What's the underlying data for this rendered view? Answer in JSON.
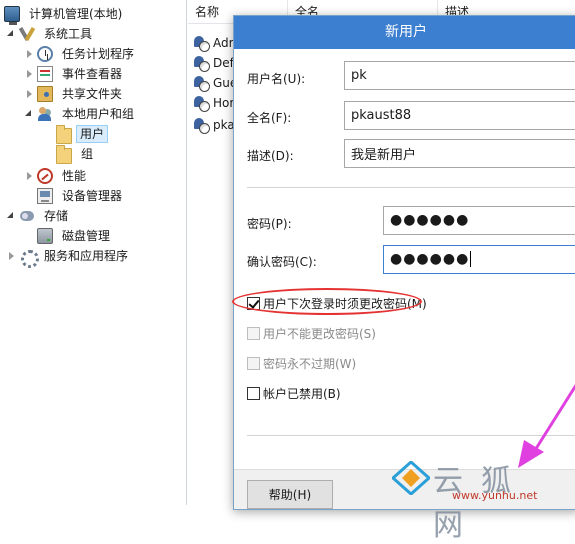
{
  "tree": {
    "items": [
      {
        "label": "计算机管理(本地)",
        "icon": "computer-management-icon"
      },
      {
        "label": "系统工具",
        "icon": "system-tools-icon"
      },
      {
        "label": "任务计划程序",
        "icon": "task-scheduler-icon"
      },
      {
        "label": "事件查看器",
        "icon": "event-viewer-icon"
      },
      {
        "label": "共享文件夹",
        "icon": "shared-folders-icon"
      },
      {
        "label": "本地用户和组",
        "icon": "local-users-groups-icon"
      },
      {
        "label": "用户",
        "icon": "folder-icon"
      },
      {
        "label": "组",
        "icon": "folder-icon"
      },
      {
        "label": "性能",
        "icon": "performance-icon"
      },
      {
        "label": "设备管理器",
        "icon": "device-manager-icon"
      },
      {
        "label": "存储",
        "icon": "storage-icon"
      },
      {
        "label": "磁盘管理",
        "icon": "disk-management-icon"
      },
      {
        "label": "服务和应用程序",
        "icon": "services-applications-icon"
      }
    ]
  },
  "list": {
    "columns": [
      "名称",
      "全名",
      "描述"
    ],
    "rows": [
      "Adr",
      "Def",
      "Gue",
      "Hor",
      "pka"
    ]
  },
  "dialog": {
    "title": "新用户",
    "username_label": "用户名(U):",
    "username_value": "pk",
    "fullname_label": "全名(F):",
    "fullname_value": "pkaust88",
    "description_label": "描述(D):",
    "description_value": "我是新用户",
    "password_label": "密码(P):",
    "password_value": "●●●●●●",
    "confirm_label": "确认密码(C):",
    "confirm_value": "●●●●●●",
    "checkboxes": [
      {
        "label": "用户下次登录时须更改密码(M)",
        "checked": true,
        "enabled": true
      },
      {
        "label": "用户不能更改密码(S)",
        "checked": false,
        "enabled": false
      },
      {
        "label": "密码永不过期(W)",
        "checked": false,
        "enabled": false
      },
      {
        "label": "帐户已禁用(B)",
        "checked": false,
        "enabled": true
      }
    ],
    "help_button": "帮助(H)"
  },
  "watermark": {
    "text": "云狐网",
    "url": "www.yunhu.net"
  },
  "colors": {
    "title_bar": "#3c7ed0",
    "highlight": "#e53333",
    "watermark_arrow": "#e040e0"
  }
}
